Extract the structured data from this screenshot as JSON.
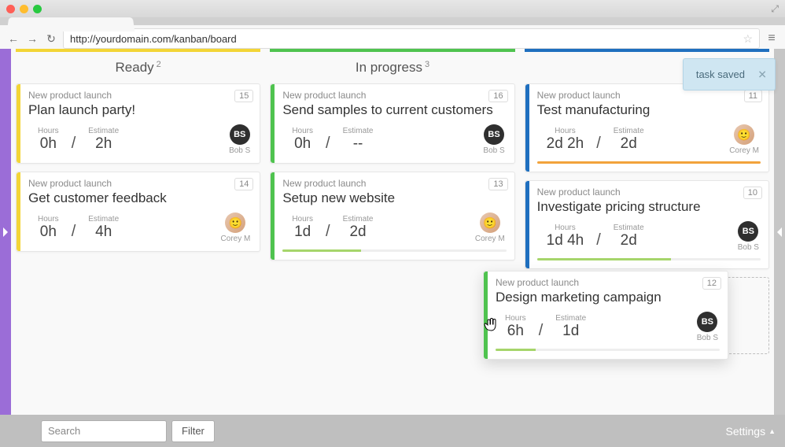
{
  "browser": {
    "url": "http://yourdomain.com/kanban/board"
  },
  "toast": {
    "text": "task saved"
  },
  "columns": [
    {
      "title": "Ready",
      "count": "2",
      "color": "yellow",
      "cards": [
        {
          "project": "New product launch",
          "title": "Plan launch party!",
          "num": "15",
          "hours": "0h",
          "estimate": "2h",
          "assignee": {
            "type": "bs",
            "name": "Bob S"
          }
        },
        {
          "project": "New product launch",
          "title": "Get customer feedback",
          "num": "14",
          "hours": "0h",
          "estimate": "4h",
          "assignee": {
            "type": "cm",
            "name": "Corey M"
          }
        }
      ]
    },
    {
      "title": "In progress",
      "count": "3",
      "color": "green",
      "cards": [
        {
          "project": "New product launch",
          "title": "Send samples to current customers",
          "num": "16",
          "hours": "0h",
          "estimate": "--",
          "assignee": {
            "type": "bs",
            "name": "Bob S"
          }
        },
        {
          "project": "New product launch",
          "title": "Setup new website",
          "num": "13",
          "hours": "1d",
          "estimate": "2d",
          "assignee": {
            "type": "cm",
            "name": "Corey M"
          },
          "progress": {
            "color": "lime",
            "pct": 35
          }
        }
      ]
    },
    {
      "title": "",
      "count": "",
      "color": "blue",
      "cards": [
        {
          "project": "New product launch",
          "title": "Test manufacturing",
          "num": "11",
          "hours": "2d 2h",
          "estimate": "2d",
          "assignee": {
            "type": "cm",
            "name": "Corey M"
          },
          "progress": {
            "color": "orange",
            "pct": 100
          }
        },
        {
          "project": "New product launch",
          "title": "Investigate pricing structure",
          "num": "10",
          "hours": "1d 4h",
          "estimate": "2d",
          "assignee": {
            "type": "bs",
            "name": "Bob S"
          },
          "progress": {
            "color": "lime",
            "pct": 60
          }
        }
      ]
    }
  ],
  "dragCard": {
    "project": "New product launch",
    "title": "Design marketing campaign",
    "num": "12",
    "hours": "6h",
    "estimate": "1d",
    "assignee": {
      "type": "bs",
      "name": "Bob S"
    },
    "progress": {
      "color": "lime",
      "pct": 18
    }
  },
  "labels": {
    "hours": "Hours",
    "estimate": "Estimate"
  },
  "footer": {
    "searchPlaceholder": "Search",
    "filter": "Filter",
    "settings": "Settings"
  }
}
